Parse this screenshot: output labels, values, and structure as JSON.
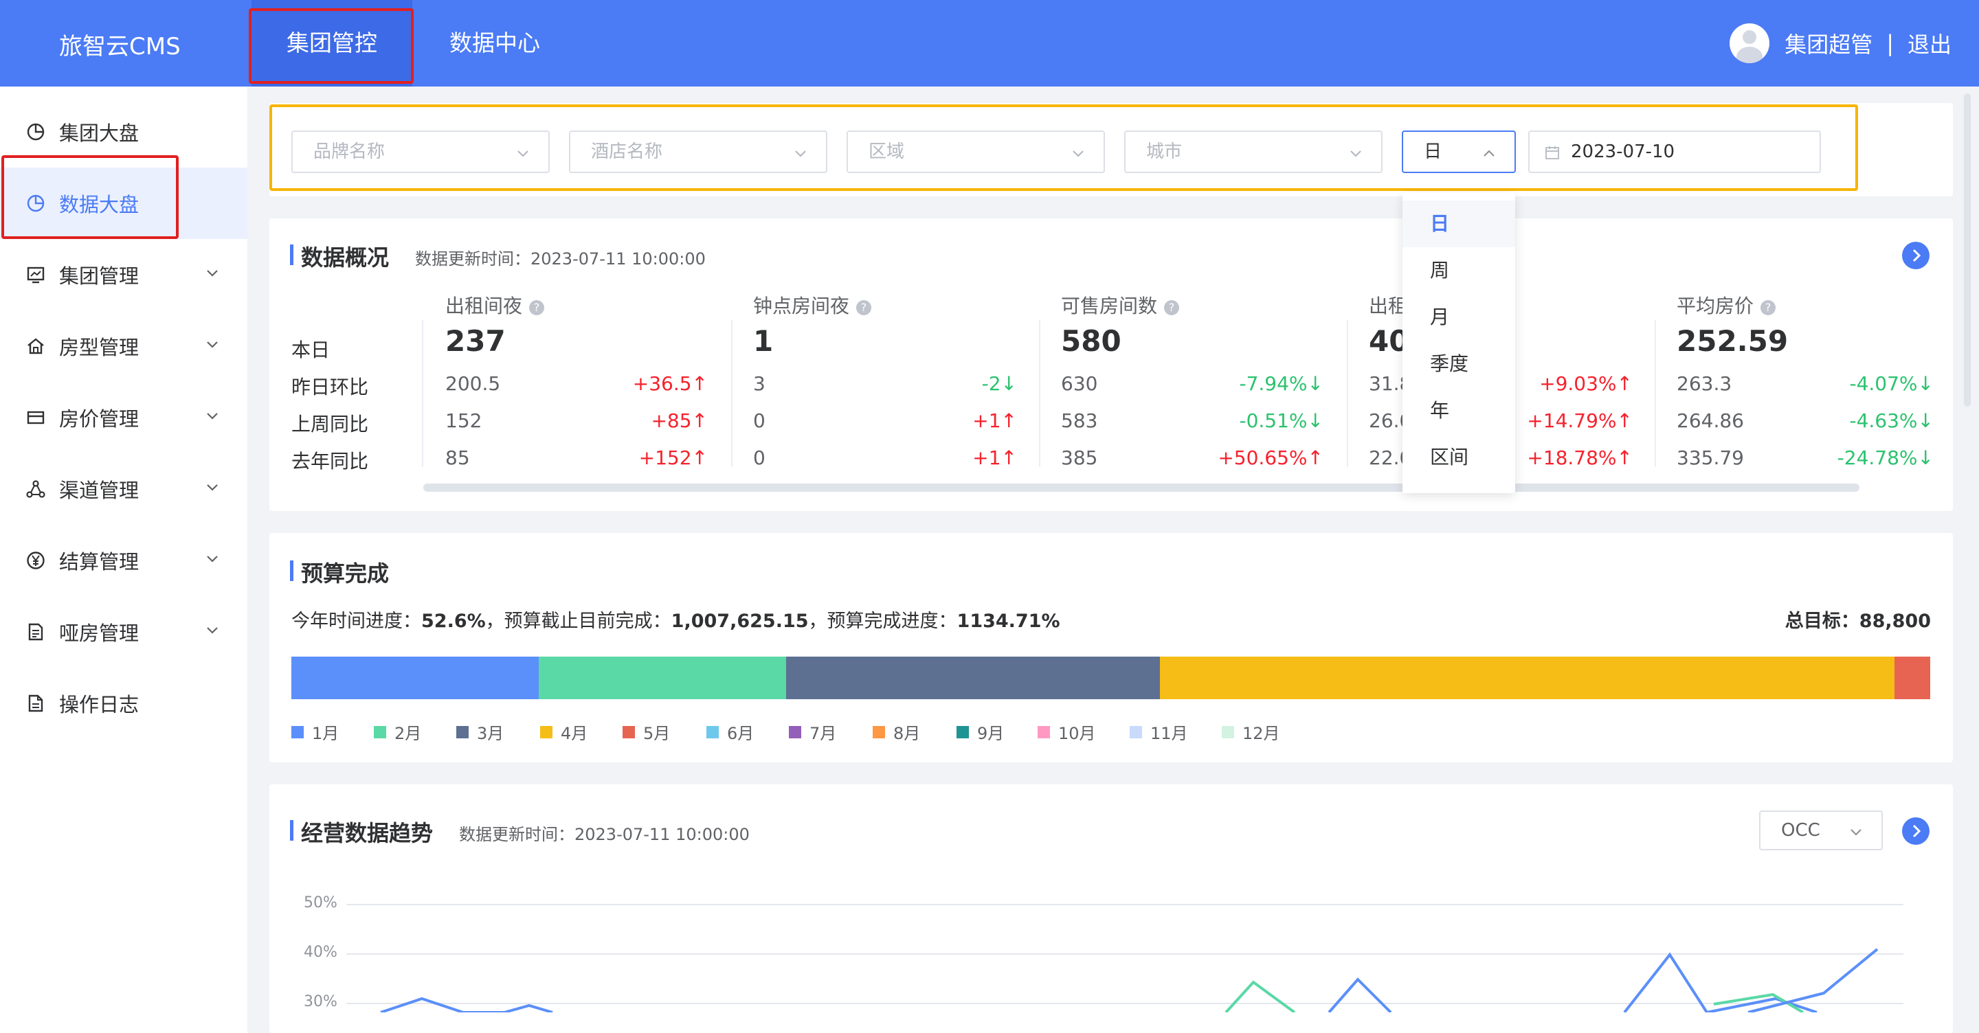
{
  "header": {
    "app_title": "旅智云CMS",
    "nav": [
      "集团管控",
      "数据中心"
    ],
    "user_name": "集团超管",
    "separator": "|",
    "logout": "退出"
  },
  "sidebar": {
    "items": [
      {
        "label": "集团大盘",
        "icon": "pie-chart-icon"
      },
      {
        "label": "数据大盘",
        "icon": "pie-chart-icon"
      },
      {
        "label": "集团管理",
        "icon": "monitor-chart-icon"
      },
      {
        "label": "房型管理",
        "icon": "home-icon"
      },
      {
        "label": "房价管理",
        "icon": "card-icon"
      },
      {
        "label": "渠道管理",
        "icon": "network-icon"
      },
      {
        "label": "结算管理",
        "icon": "yen-circle-icon"
      },
      {
        "label": "哑房管理",
        "icon": "document-icon"
      },
      {
        "label": "操作日志",
        "icon": "file-icon"
      }
    ]
  },
  "filters": {
    "brand_placeholder": "品牌名称",
    "hotel_placeholder": "酒店名称",
    "region_placeholder": "区域",
    "city_placeholder": "城市",
    "period_value": "日",
    "date_value": "2023-07-10"
  },
  "period_dropdown": {
    "options": [
      "日",
      "周",
      "月",
      "季度",
      "年",
      "区间"
    ],
    "selected": "日"
  },
  "overview": {
    "title": "数据概况",
    "updated": "数据更新时间：2023-07-11 10:00:00",
    "row_labels": [
      "本日",
      "昨日环比",
      "上周同比",
      "去年同比"
    ],
    "metrics": [
      {
        "name": "出租间夜",
        "today": "237",
        "rows": [
          {
            "value": "200.5",
            "change": "+36.5↑"
          },
          {
            "value": "152",
            "change": "+85↑"
          },
          {
            "value": "85",
            "change": "+152↑"
          }
        ]
      },
      {
        "name": "钟点房间夜",
        "today": "1",
        "rows": [
          {
            "value": "3",
            "change": "-2↓"
          },
          {
            "value": "0",
            "change": "+1↑"
          },
          {
            "value": "0",
            "change": "+1↑"
          }
        ]
      },
      {
        "name": "可售房间数",
        "today": "580",
        "rows": [
          {
            "value": "630",
            "change": "-7.94%↓"
          },
          {
            "value": "583",
            "change": "-0.51%↓"
          },
          {
            "value": "385",
            "change": "+50.65%↑"
          }
        ]
      },
      {
        "name": "出租",
        "today": "40",
        "rows": [
          {
            "value": "31.8",
            "change": "+9.03%↑"
          },
          {
            "value": "26.0",
            "change": "+14.79%↑"
          },
          {
            "value": "22.0",
            "change": "+18.78%↑"
          }
        ]
      },
      {
        "name": "平均房价",
        "today": "252.59",
        "rows": [
          {
            "value": "263.3",
            "change": "-4.07%↓"
          },
          {
            "value": "264.86",
            "change": "-4.63%↓"
          },
          {
            "value": "335.79",
            "change": "-24.78%↓"
          }
        ]
      }
    ]
  },
  "budget": {
    "title": "预算完成",
    "line_prefix1": "今年时间进度：",
    "time_progress": "52.6%",
    "line_prefix2": "，预算截止目前完成：",
    "completed": "1,007,625.15",
    "line_prefix3": "，预算完成进度：",
    "completion": "1134.71%",
    "total_label": "总目标：",
    "total_value": "88,800",
    "segments": [
      0.151,
      0.151,
      0.228,
      0.448,
      0.022
    ],
    "months": [
      "1月",
      "2月",
      "3月",
      "4月",
      "5月",
      "6月",
      "7月",
      "8月",
      "9月",
      "10月",
      "11月",
      "12月"
    ],
    "month_colors": [
      "#5b8ff9",
      "#5ad8a6",
      "#5d7092",
      "#f6bd16",
      "#e86452",
      "#6dc8ec",
      "#945fb9",
      "#ff9845",
      "#1e9493",
      "#ff99c3",
      "#c9dafc",
      "#d3f2e2"
    ]
  },
  "trend": {
    "title": "经营数据趋势",
    "updated": "数据更新时间：2023-07-11 10:00:00",
    "metric_select": "OCC",
    "y_ticks": [
      "50%",
      "40%",
      "30%"
    ]
  },
  "colors": {
    "primary": "#4b7bf5",
    "up": "#f5222d",
    "down": "#2bc26e",
    "highlight_red": "#e02020",
    "highlight_yellow": "#f7b500"
  }
}
